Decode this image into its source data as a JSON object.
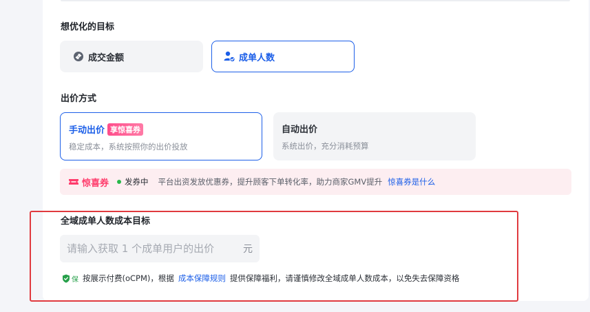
{
  "goal": {
    "title": "想优化的目标",
    "options": [
      {
        "label": "成交金额",
        "icon": "swap-coin-icon",
        "selected": false
      },
      {
        "label": "成单人数",
        "icon": "user-check-icon",
        "selected": true
      }
    ]
  },
  "bidding": {
    "title": "出价方式",
    "manual": {
      "title": "手动出价",
      "tag": "享惊喜券",
      "desc": "稳定成本，系统按照你的出价投放",
      "selected": true
    },
    "auto": {
      "title": "自动出价",
      "desc": "系统出价，充分消耗预算",
      "selected": false
    }
  },
  "promo": {
    "brand": "惊喜券",
    "status": "发券中",
    "text": "平台出资发放优惠券，提升顾客下单转化率，助力商家GMV提升",
    "link": "惊喜券是什么",
    "colors": {
      "brand": "#ff3b6b",
      "status_dot": "#27b84a"
    }
  },
  "cost_target": {
    "title": "全域成单人数成本目标",
    "input_placeholder": "请输入获取 1 个成单用户的出价",
    "unit": "元",
    "badge": "保",
    "note_prefix": "按展示付费(oCPM)，根据",
    "note_link": "成本保障规则",
    "note_suffix": "提供保障福利，请谨慎修改全域成单人数成本，以免失去保障资格"
  },
  "colors": {
    "accent": "#1b5ee8",
    "highlight_border": "#e0393e"
  }
}
